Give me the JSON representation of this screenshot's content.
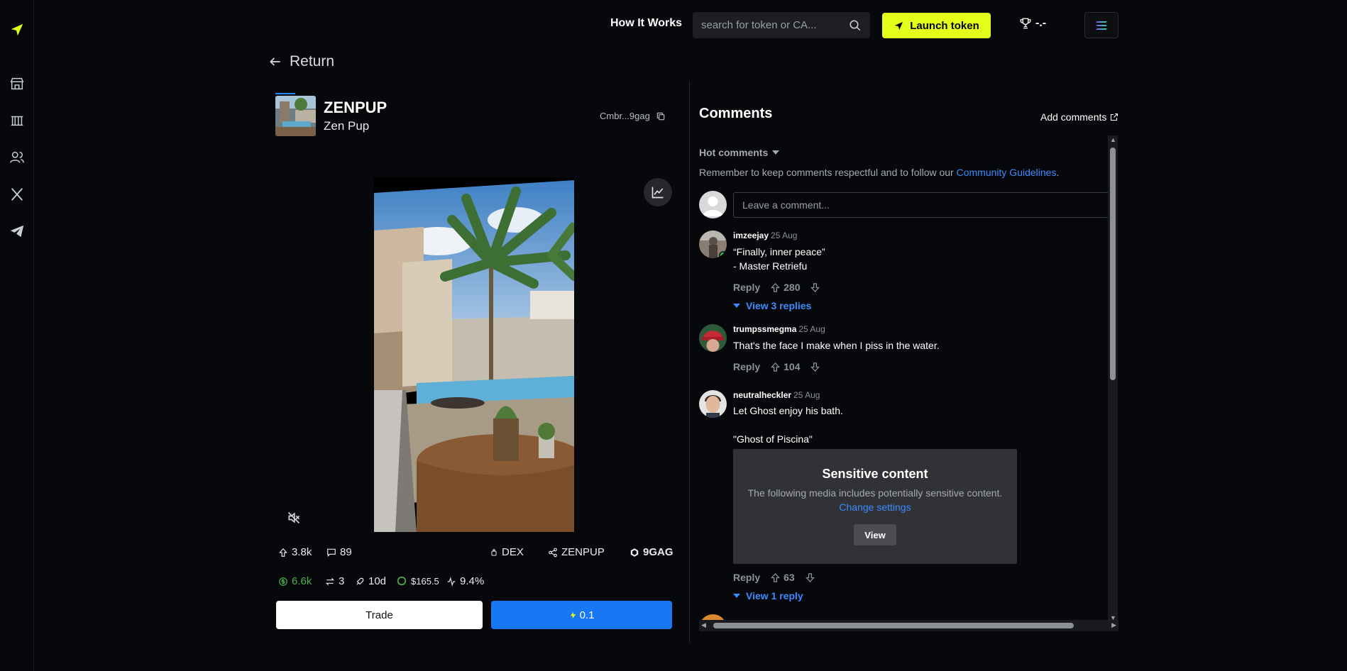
{
  "nav": {
    "how_it_works": "How It Works",
    "search_placeholder": "search for token or CA...",
    "launch_label": "Launch token",
    "trophy_value": "-.-"
  },
  "return_label": "Return",
  "token": {
    "ticker": "ZENPUP",
    "name": "Zen Pup",
    "ca_short": "Cmbr...9gag"
  },
  "stats": {
    "upvotes": "3.8k",
    "comments": "89",
    "dex": "DEX",
    "share": "ZENPUP",
    "source": "9GAG",
    "mcap": "6.6k",
    "trades": "3",
    "age": "10d",
    "price": "$165.5",
    "change": "9.4%"
  },
  "actions": {
    "trade": "Trade",
    "quick_buy": "0.1"
  },
  "comments_panel": {
    "title": "Comments",
    "add_label": "Add comments",
    "sort_label": "Hot comments",
    "remember_text": "Remember to keep comments respectful and to follow our ",
    "guidelines_link": "Community Guidelines",
    "guidelines_end": ".",
    "input_placeholder": "Leave a comment...",
    "reply_label": "Reply",
    "items": [
      {
        "user": "imzeejay",
        "time": "25 Aug",
        "line1": "“Finally, inner peace”",
        "line2": "- Master Retriefu",
        "upvotes": "280",
        "replies": "View 3 replies"
      },
      {
        "user": "trumpssmegma",
        "time": "25 Aug",
        "line1": "That's the face I make when I piss in the water.",
        "upvotes": "104"
      },
      {
        "user": "neutralheckler",
        "time": "25 Aug",
        "line1": "Let Ghost enjoy his bath.",
        "line2": "\"Ghost of Piscina\"",
        "upvotes": "63",
        "replies": "View 1 reply"
      }
    ],
    "sensitive": {
      "title": "Sensitive content",
      "desc": "The following media includes potentially sensitive content.",
      "link": "Change settings",
      "button": "View"
    }
  },
  "colors": {
    "accent_yellow": "#e4ff1a",
    "accent_blue": "#1877f2",
    "link_blue": "#3b8cff",
    "mcap_green": "#4caf50"
  }
}
